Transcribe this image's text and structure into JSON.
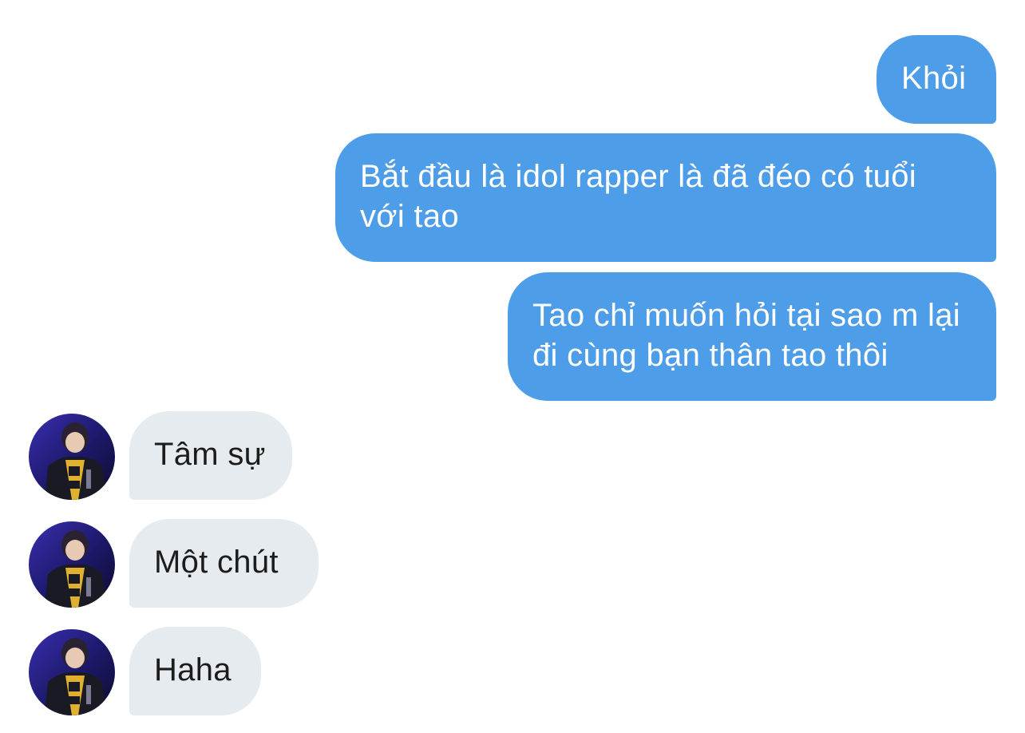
{
  "conversation": {
    "sent": [
      {
        "text": "Khỏi"
      },
      {
        "text": "Bắt đầu là idol rapper là đã đéo có tuổi với tao"
      },
      {
        "text": "Tao chỉ muốn hỏi tại sao m lại đi cùng bạn thân tao thôi"
      }
    ],
    "received": [
      {
        "text": "Tâm sự"
      },
      {
        "text": "Một chút"
      },
      {
        "text": "Haha"
      }
    ]
  },
  "colors": {
    "sent_bubble": "#4d9de8",
    "received_bubble": "#e6ebf0",
    "sent_text": "#ffffff",
    "received_text": "#1c1c1c"
  },
  "icons": {
    "avatar": "contact-avatar-photo"
  }
}
